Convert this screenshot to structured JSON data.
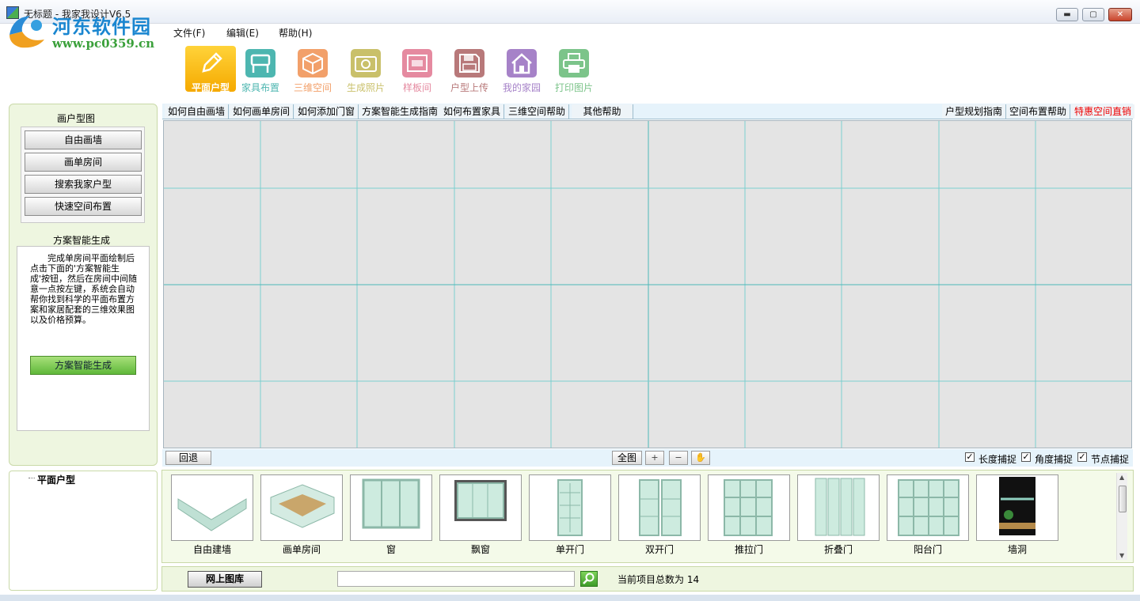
{
  "window": {
    "title": "无标题 - 我家我设计V6.5",
    "watermark_title": "河东软件园",
    "watermark_url": "www.pc0359.cn",
    "controls": {
      "minimize": "▬",
      "maximize": "▢",
      "close": "✕"
    }
  },
  "menu": {
    "file": "文件(F)",
    "edit": "编辑(E)",
    "help": "帮助(H)"
  },
  "toolbar": [
    {
      "label": "平面户型",
      "icon": "pencil-icon",
      "color": "#f5b400",
      "active": true
    },
    {
      "label": "家具布置",
      "icon": "chair-icon",
      "color": "#4db6b0"
    },
    {
      "label": "三维空间",
      "icon": "cube-icon",
      "color": "#f2a06a"
    },
    {
      "label": "生成照片",
      "icon": "camera-icon",
      "color": "#c9c06a"
    },
    {
      "label": "样板间",
      "icon": "room-icon",
      "color": "#e58aa0"
    },
    {
      "label": "户型上传",
      "icon": "floppy-icon",
      "color": "#b8797a"
    },
    {
      "label": "我的家园",
      "icon": "house-icon",
      "color": "#a682c8"
    },
    {
      "label": "打印图片",
      "icon": "printer-icon",
      "color": "#7cc48a"
    }
  ],
  "left_panel": {
    "draw_title": "画户型图",
    "buttons": [
      "自由画墙",
      "画单房间",
      "搜索我家户型",
      "快速空间布置"
    ],
    "smart_title": "方案智能生成",
    "description": "完成单房间平面绘制后点击下面的'方案智能生成'按钮，然后在房间中间随意一点按左键，系统会自动帮你找到科学的平面布置方案和家居配套的三维效果图以及价格预算。",
    "smart_button": "方案智能生成"
  },
  "tree": {
    "root": "平面户型"
  },
  "help_links": {
    "left": [
      "如何自由画墙",
      "如何画单房间",
      "如何添加门窗",
      "方案智能生成指南",
      "如何布置家具",
      "三维空间帮助",
      "其他帮助"
    ],
    "right": [
      "户型规划指南",
      "空间布置帮助",
      "特惠空间直销"
    ]
  },
  "canvas_bar": {
    "undo": "回退",
    "full": "全图",
    "zoom_in": "+",
    "zoom_out": "−",
    "pan": "✋",
    "snaps": [
      {
        "label": "长度捕捉",
        "checked": true
      },
      {
        "label": "角度捕捉",
        "checked": true
      },
      {
        "label": "节点捕捉",
        "checked": true
      }
    ],
    "check_mark": "✓"
  },
  "catalog": [
    {
      "label": "自由建墙",
      "icon": "wall-icon"
    },
    {
      "label": "画单房间",
      "icon": "room-box-icon"
    },
    {
      "label": "窗",
      "icon": "window-icon"
    },
    {
      "label": "飘窗",
      "icon": "bay-window-icon"
    },
    {
      "label": "单开门",
      "icon": "single-door-icon"
    },
    {
      "label": "双开门",
      "icon": "double-door-icon"
    },
    {
      "label": "推拉门",
      "icon": "sliding-door-icon"
    },
    {
      "label": "折叠门",
      "icon": "folding-door-icon"
    },
    {
      "label": "阳台门",
      "icon": "balcony-door-icon"
    },
    {
      "label": "墙洞",
      "icon": "wall-opening-icon"
    }
  ],
  "bottom": {
    "online_library": "网上图库",
    "search_value": "",
    "total_label": "当前项目总数为 14"
  }
}
